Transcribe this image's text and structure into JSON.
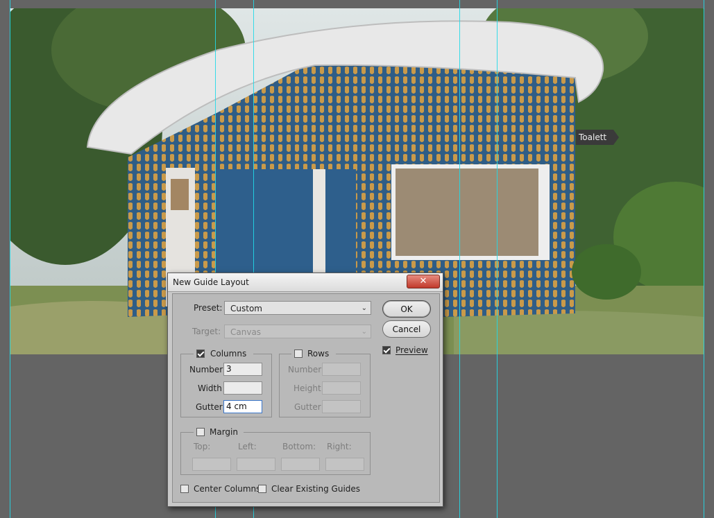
{
  "photo": {
    "sign_text": "Toalett"
  },
  "dialog": {
    "title": "New Guide Layout",
    "close_symbol": "✕",
    "preset": {
      "label": "Preset:",
      "value": "Custom"
    },
    "target": {
      "label": "Target:",
      "value": "Canvas"
    },
    "columns": {
      "label": "Columns",
      "checked": true,
      "number_label": "Number",
      "number_value": "3",
      "width_label": "Width",
      "width_value": "",
      "gutter_label": "Gutter",
      "gutter_value": "4 cm"
    },
    "rows": {
      "label": "Rows",
      "checked": false,
      "number_label": "Number",
      "height_label": "Height",
      "gutter_label": "Gutter"
    },
    "margin": {
      "label": "Margin",
      "checked": false,
      "top_label": "Top:",
      "left_label": "Left:",
      "bottom_label": "Bottom:",
      "right_label": "Right:"
    },
    "center_columns_label": "Center Columns",
    "clear_guides_label": "Clear Existing Guides",
    "ok_label": "OK",
    "cancel_label": "Cancel",
    "preview_label": "Preview",
    "preview_checked": true
  },
  "colors": {
    "guide": "#21d9e8",
    "workspace": "#646464",
    "dialog_bg": "#c8c8c8",
    "close_button": "#c0392b"
  }
}
